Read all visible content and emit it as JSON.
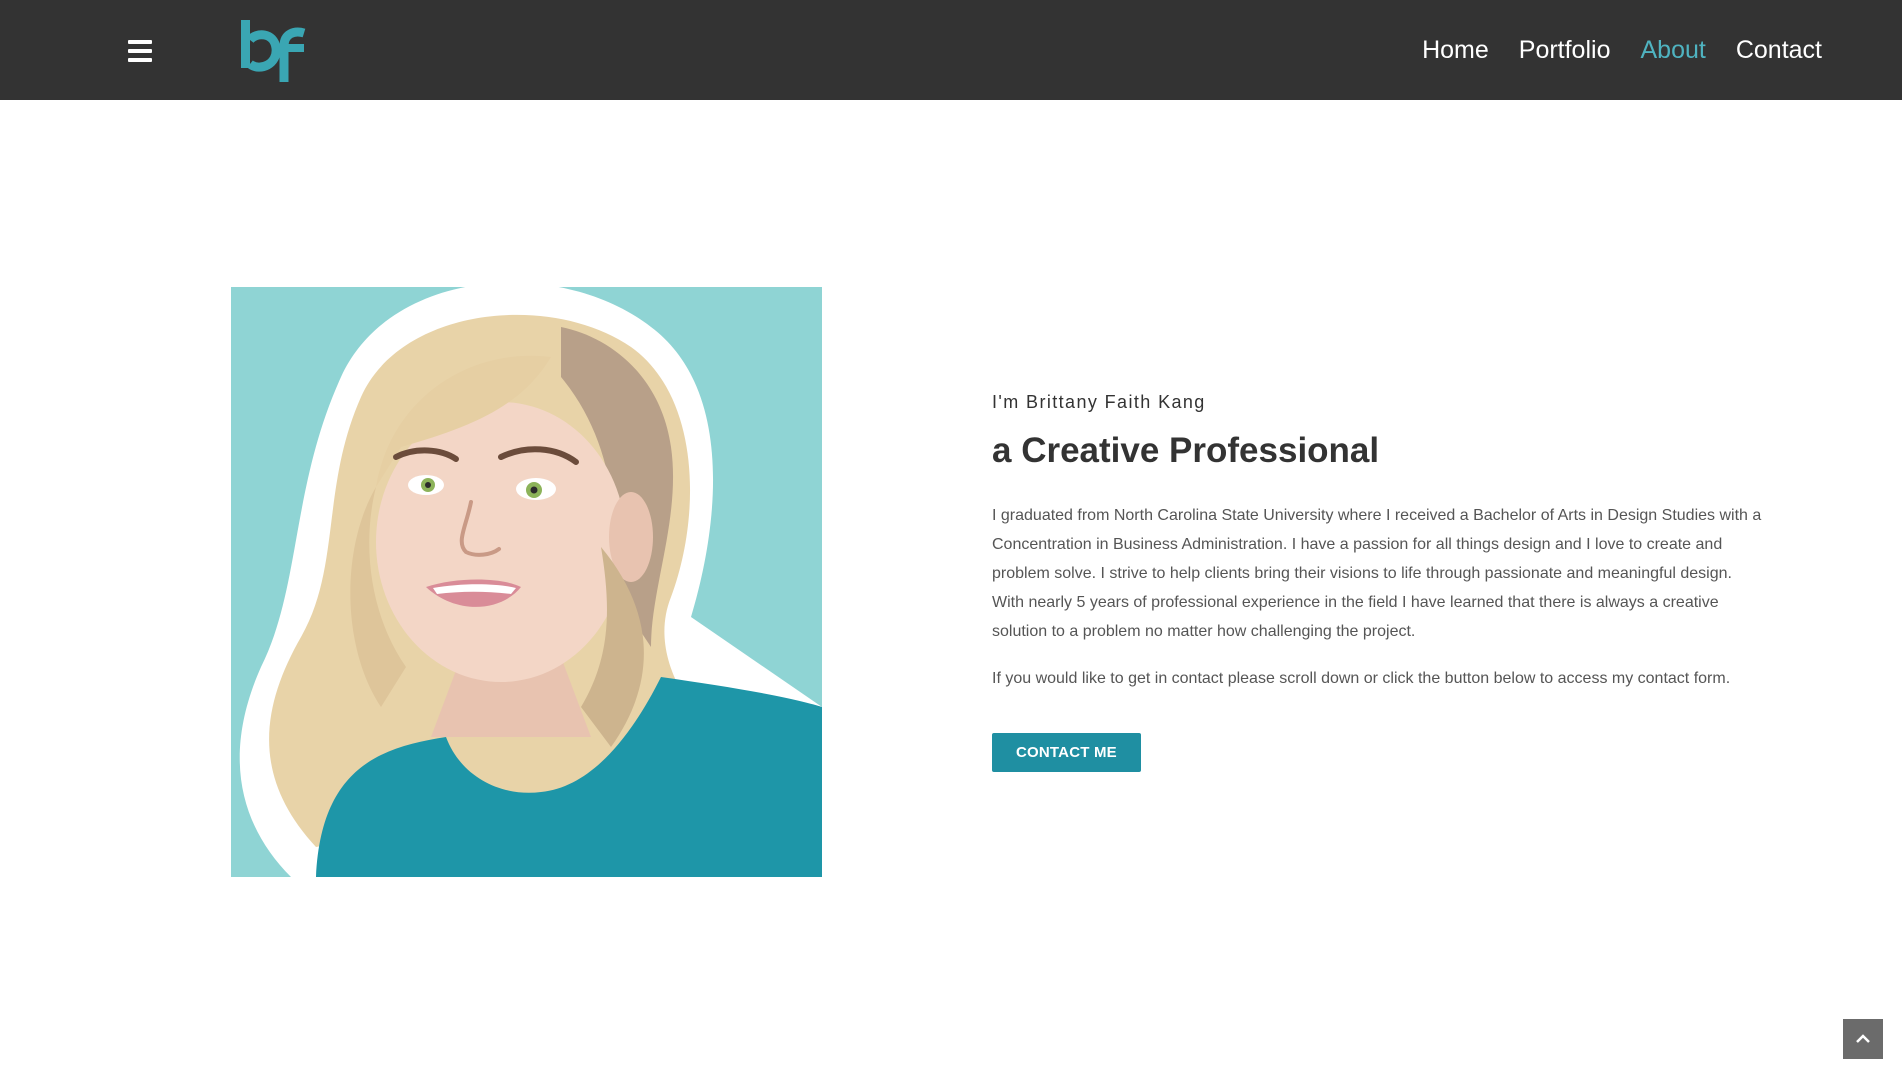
{
  "header": {
    "logo_text": "bf",
    "nav": [
      {
        "label": "Home"
      },
      {
        "label": "Portfolio"
      },
      {
        "label": "About"
      },
      {
        "label": "Contact"
      }
    ],
    "active_item": "About"
  },
  "about": {
    "eyebrow": "I'm Brittany Faith Kang",
    "headline": "a Creative Professional",
    "paragraph1": "I graduated from North Carolina State University where I received a Bachelor of Arts in Design Studies with a Concentration in Business Administration. I have a passion for all things design and I love to create and problem solve. I strive to help clients bring their visions to life through passionate and meaningful design. With nearly 5 years of professional experience in the field I have learned that there is always a creative solution to a problem no matter how challenging the project.",
    "paragraph2": "If you would like to get in contact please scroll down or click the button below to access my contact form.",
    "cta_label": "CONTACT ME"
  },
  "icons": {
    "menu": "hamburger-icon",
    "scroll_top": "chevron-up-icon"
  },
  "colors": {
    "header_bg": "#333333",
    "accent": "#4fb3c0",
    "button": "#1f8fa2",
    "portrait_bg": "#8fd4d4",
    "shirt": "#1e96a8"
  }
}
